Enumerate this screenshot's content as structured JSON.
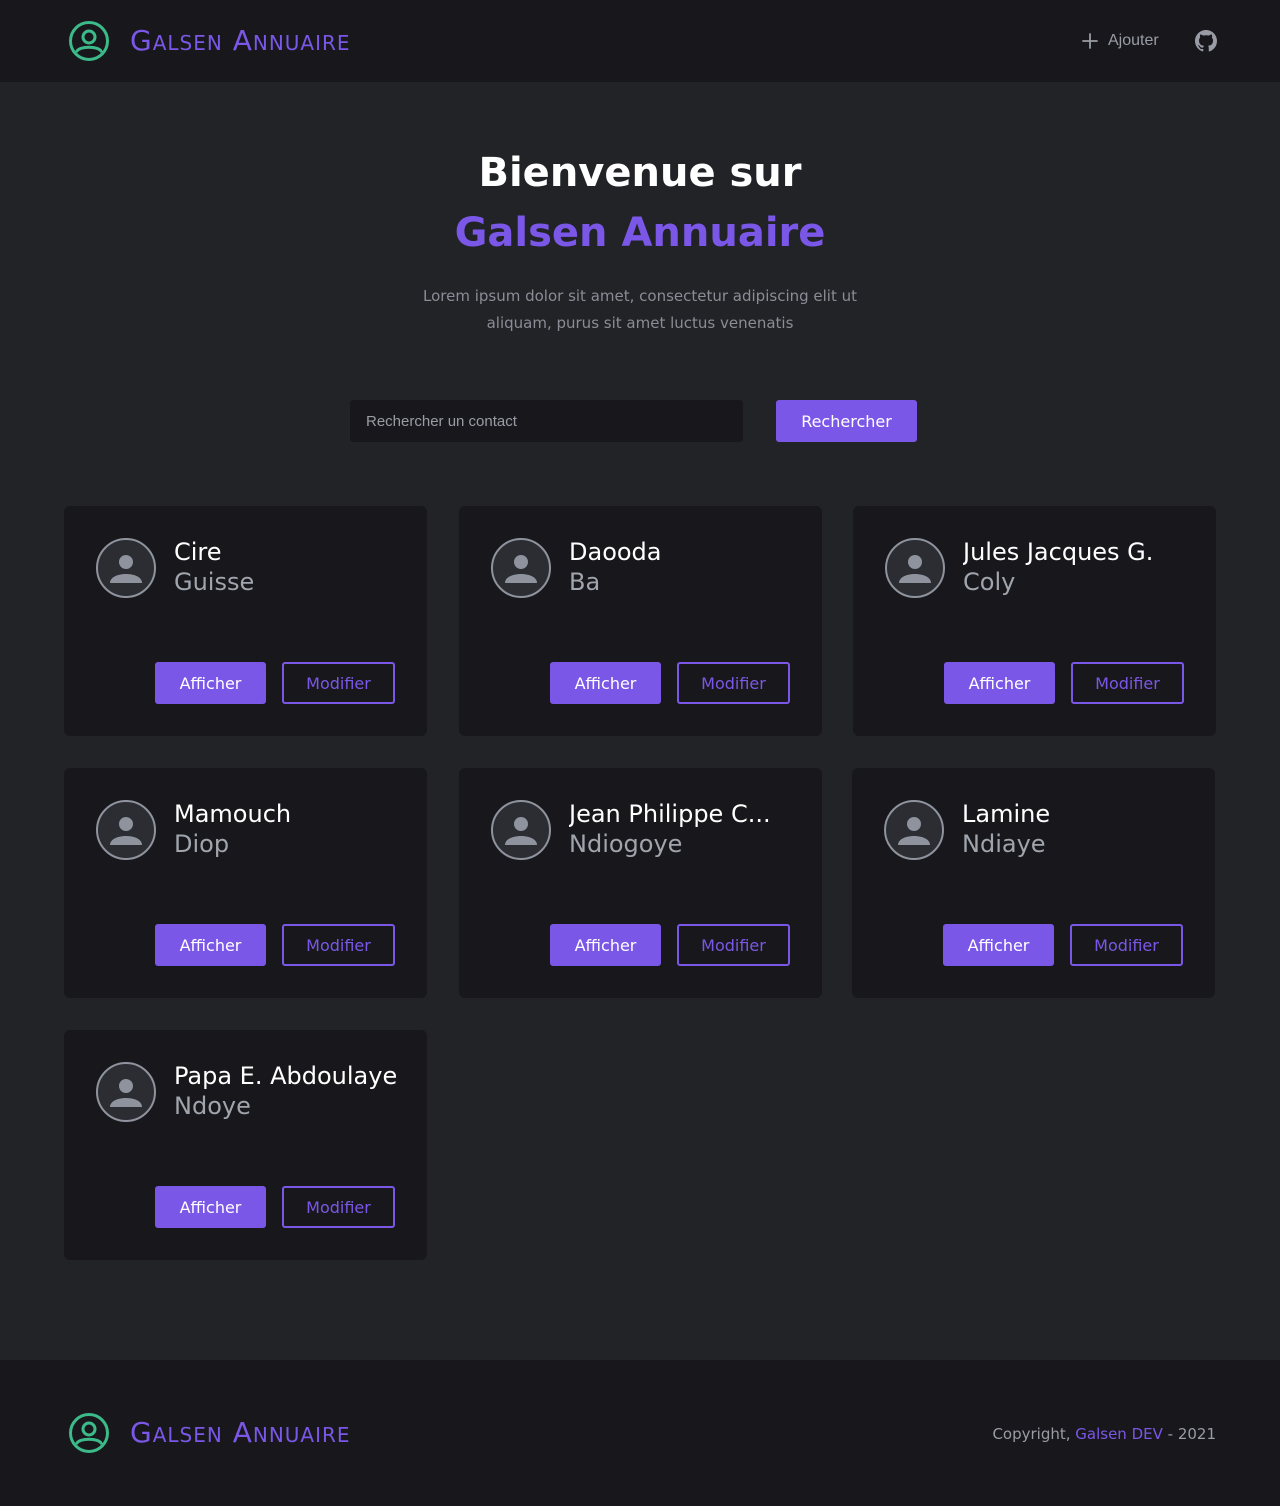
{
  "app": {
    "brand": "Galsen Annuaire",
    "colors": {
      "accent": "#7b57e8",
      "logo": "#3dba8a",
      "background": "#222327",
      "surface": "#18181c"
    }
  },
  "header": {
    "logo_icon": "user-circle-icon",
    "add_label": "Ajouter",
    "add_icon": "plus-icon",
    "github_icon": "github-icon"
  },
  "hero": {
    "title": "Bienvenue sur",
    "brand": "Galsen Annuaire",
    "description": "Lorem ipsum dolor sit amet, consectetur adipiscing elit ut aliquam, purus sit amet luctus venenatis"
  },
  "search": {
    "placeholder": "Rechercher un contact",
    "value": "",
    "button_label": "Rechercher"
  },
  "contacts": [
    {
      "first_name": "Cire",
      "last_name": "Guisse",
      "show_label": "Afficher",
      "edit_label": "Modifier"
    },
    {
      "first_name": "Daooda",
      "last_name": "Ba",
      "show_label": "Afficher",
      "edit_label": "Modifier"
    },
    {
      "first_name": "Jules Jacques G.",
      "last_name": "Coly",
      "show_label": "Afficher",
      "edit_label": "Modifier"
    },
    {
      "first_name": "Mamouch",
      "last_name": "Diop",
      "show_label": "Afficher",
      "edit_label": "Modifier"
    },
    {
      "first_name": "Jean Philippe C...",
      "last_name": "Ndiogoye",
      "show_label": "Afficher",
      "edit_label": "Modifier"
    },
    {
      "first_name": "Lamine",
      "last_name": "Ndiaye",
      "show_label": "Afficher",
      "edit_label": "Modifier"
    },
    {
      "first_name": "Papa E. Abdoulaye",
      "last_name": "Ndoye",
      "show_label": "Afficher",
      "edit_label": "Modifier"
    }
  ],
  "footer": {
    "brand": "Galsen Annuaire",
    "copyright_prefix": "Copyright, ",
    "copyright_link": "Galsen DEV",
    "copyright_suffix": " - 2021"
  }
}
